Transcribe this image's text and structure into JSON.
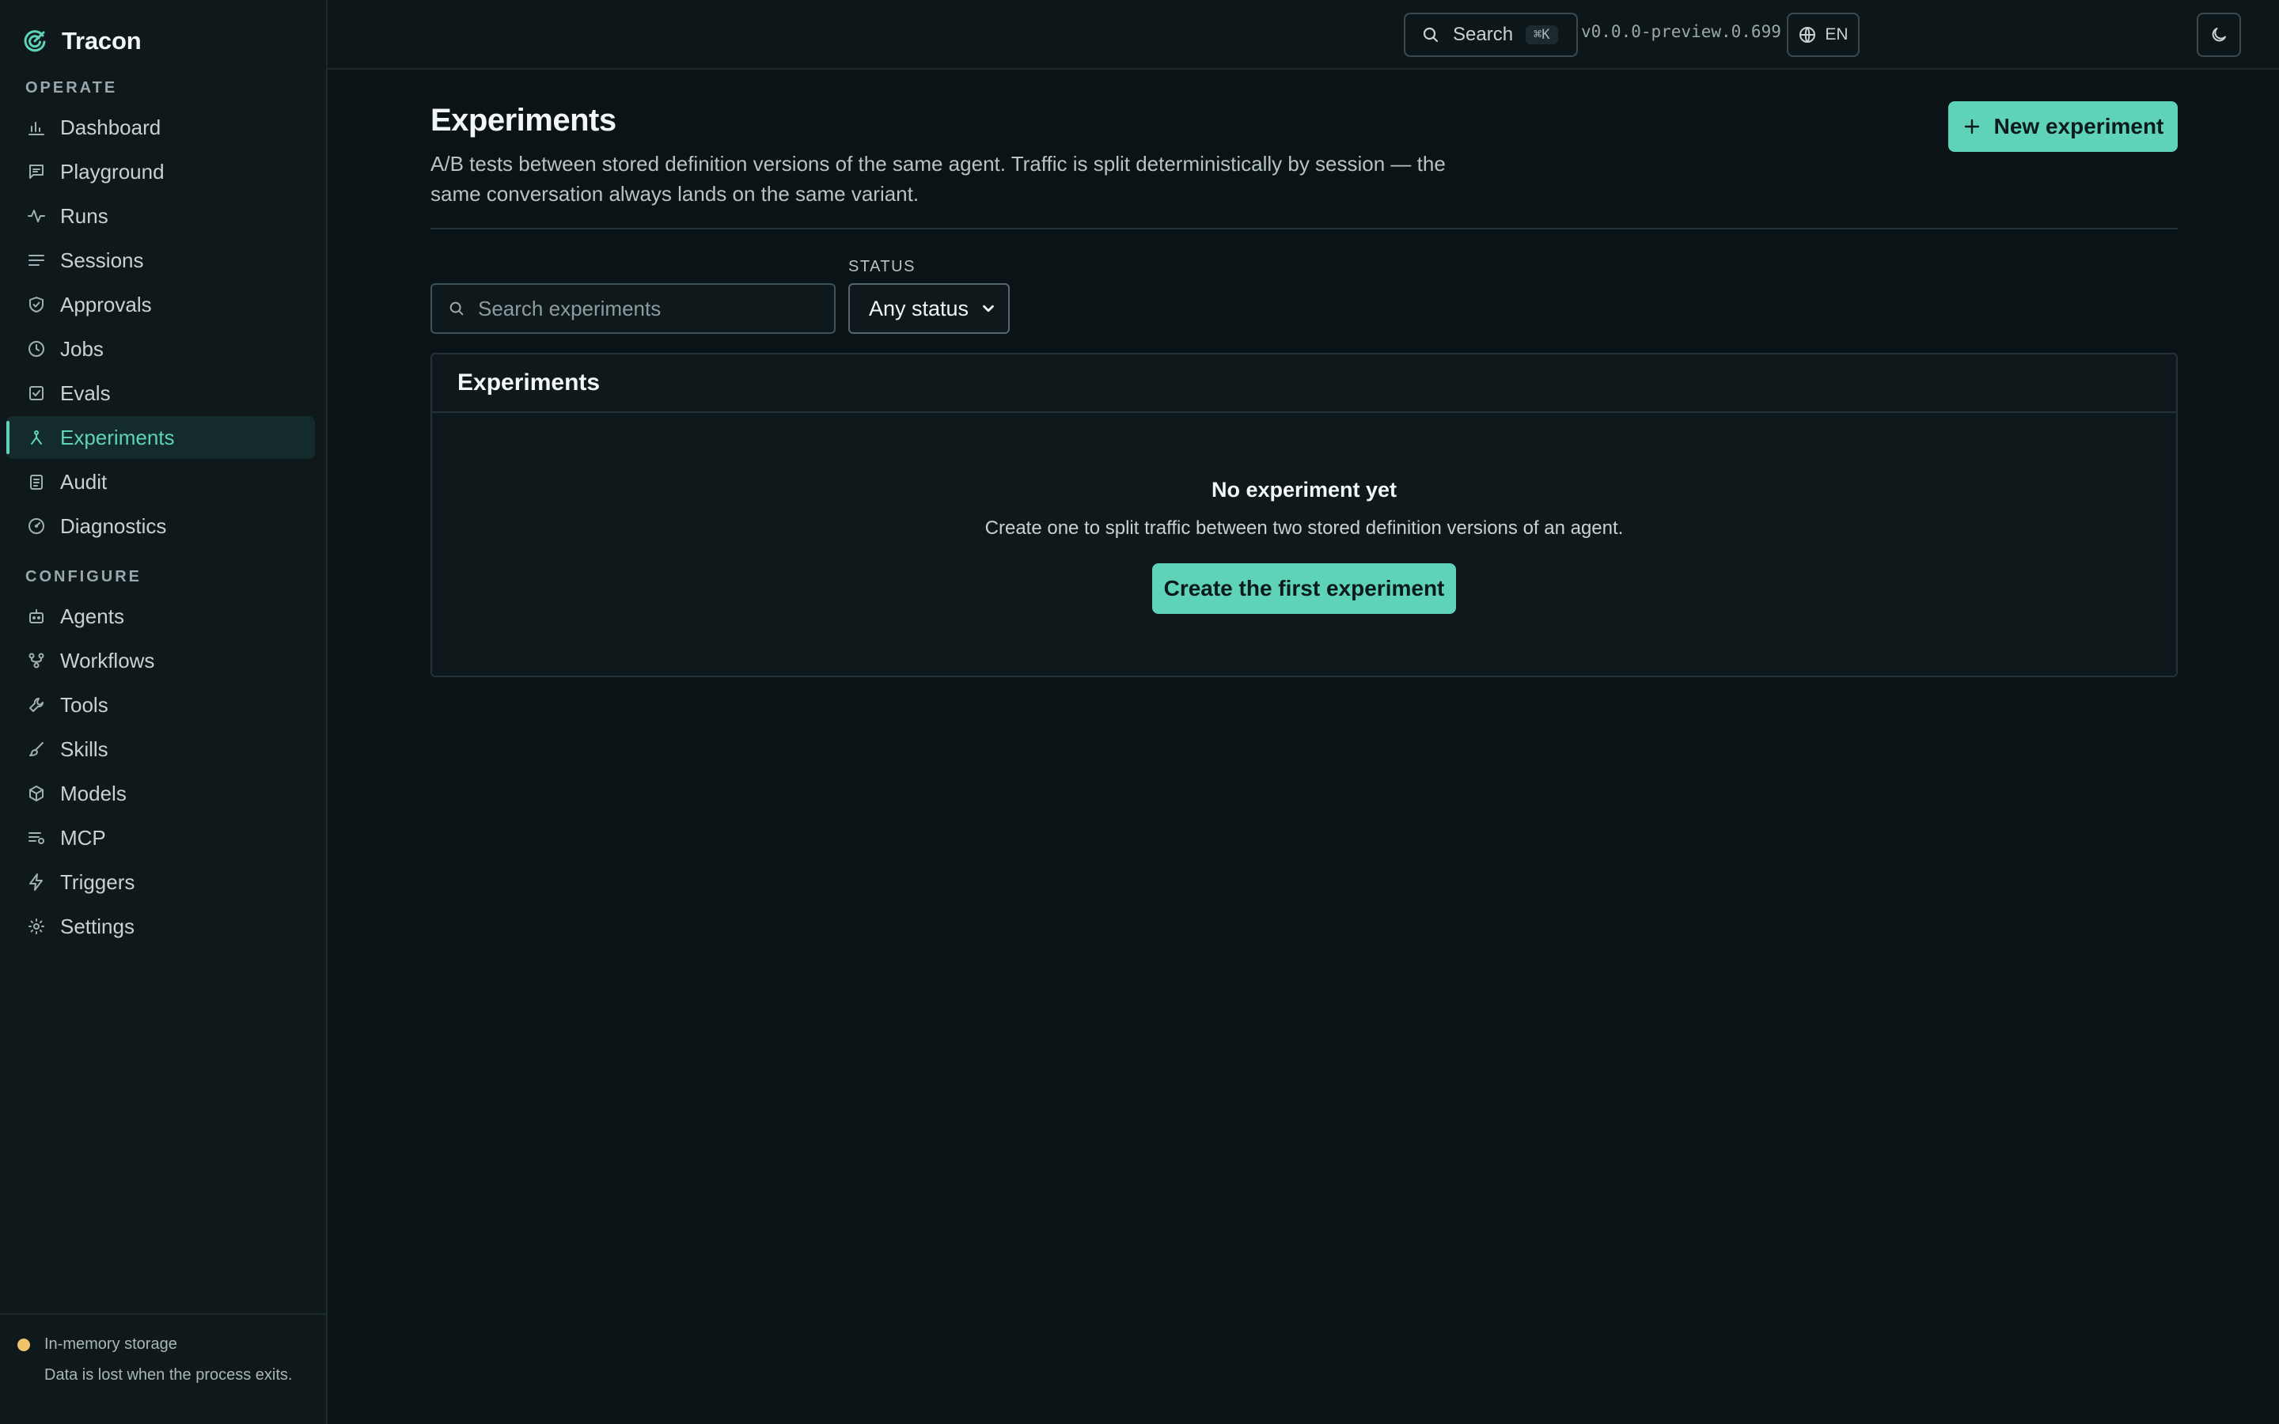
{
  "app": {
    "name": "Tracon"
  },
  "colors": {
    "accent": "#5fd3b8",
    "background": "#0a1316",
    "sidebar": "#0f191c",
    "warning_dot": "#f0c36d"
  },
  "sidebar": {
    "operate_label": "OPERATE",
    "operate_items": [
      {
        "label": "Dashboard",
        "icon": "bar-chart-icon"
      },
      {
        "label": "Playground",
        "icon": "chat-icon"
      },
      {
        "label": "Runs",
        "icon": "activity-icon"
      },
      {
        "label": "Sessions",
        "icon": "list-icon"
      },
      {
        "label": "Approvals",
        "icon": "shield-check-icon"
      },
      {
        "label": "Jobs",
        "icon": "clock-icon"
      },
      {
        "label": "Evals",
        "icon": "checkbox-icon"
      },
      {
        "label": "Experiments",
        "icon": "split-icon",
        "active": true
      },
      {
        "label": "Audit",
        "icon": "clipboard-icon"
      },
      {
        "label": "Diagnostics",
        "icon": "gauge-icon"
      }
    ],
    "configure_label": "CONFIGURE",
    "configure_items": [
      {
        "label": "Agents",
        "icon": "bot-icon"
      },
      {
        "label": "Workflows",
        "icon": "workflow-icon"
      },
      {
        "label": "Tools",
        "icon": "wrench-icon"
      },
      {
        "label": "Skills",
        "icon": "brush-icon"
      },
      {
        "label": "Models",
        "icon": "cube-icon"
      },
      {
        "label": "MCP",
        "icon": "server-list-icon"
      },
      {
        "label": "Triggers",
        "icon": "bolt-icon"
      },
      {
        "label": "Settings",
        "icon": "sun-gear-icon"
      }
    ],
    "footer": {
      "title": "In-memory storage",
      "description": "Data is lost when the process exits."
    }
  },
  "topbar": {
    "search_label": "Search",
    "search_shortcut": "⌘K",
    "version": "v0.0.0-preview.0.699",
    "language": "EN"
  },
  "main": {
    "title": "Experiments",
    "description": "A/B tests between stored definition versions of the same agent. Traffic is split deterministically by session — the same conversation always lands on the same variant.",
    "new_button": "New experiment",
    "filters": {
      "search_placeholder": "Search experiments",
      "search_value": "",
      "status_label": "STATUS",
      "status_value": "Any status"
    },
    "panel": {
      "title": "Experiments",
      "empty_title": "No experiment yet",
      "empty_description": "Create one to split traffic between two stored definition versions of an agent.",
      "create_button": "Create the first experiment"
    }
  }
}
